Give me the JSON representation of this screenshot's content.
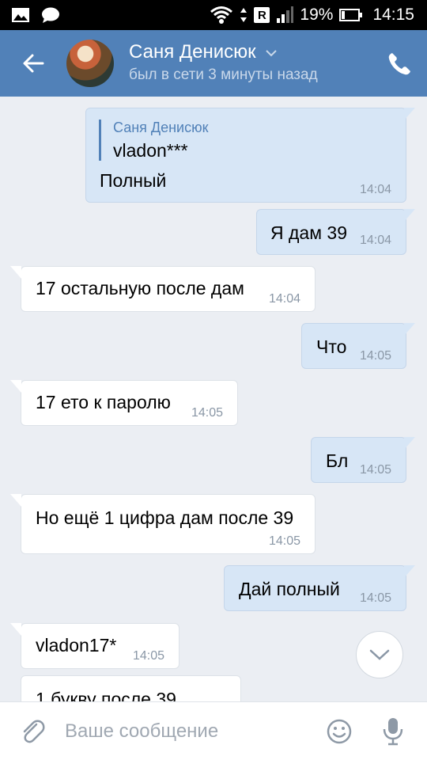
{
  "statusbar": {
    "battery": "19%",
    "battery_level": 0.19,
    "time": "14:15",
    "icons": [
      "image-icon",
      "chat-bubble-icon",
      "wifi-icon",
      "roaming-r-icon",
      "signal-icon",
      "battery-icon"
    ]
  },
  "header": {
    "contact_name": "Саня Денисюк",
    "status": "был в сети 3 минуты назад",
    "icons": [
      "back-arrow-icon",
      "chevron-down-icon",
      "phone-icon"
    ],
    "accent": "#5181b8"
  },
  "messages": [
    {
      "dir": "out",
      "quote_name": "Саня Денисюк",
      "quote_text": "vladon***",
      "text": "Полный",
      "time": "14:04"
    },
    {
      "dir": "out",
      "text": "Я дам 39",
      "time": "14:04"
    },
    {
      "dir": "in",
      "text": "17 остальную после дам",
      "time": "14:04"
    },
    {
      "dir": "out",
      "text": "Что",
      "time": "14:05"
    },
    {
      "dir": "in",
      "text": "17 ето к паролю",
      "time": "14:05"
    },
    {
      "dir": "out",
      "text": "Бл",
      "time": "14:05"
    },
    {
      "dir": "in",
      "text": "Но ещё 1 цифра дам после 39",
      "time": "14:05"
    },
    {
      "dir": "out",
      "text": "Дай полный",
      "time": "14:05"
    },
    {
      "dir": "in",
      "text": "vladon17*",
      "time": "14:05"
    },
    {
      "dir": "in",
      "text": "1 букву после 39",
      "time": ""
    }
  ],
  "composer": {
    "placeholder": "Ваше сообщение",
    "icons": [
      "paperclip-icon",
      "smiley-icon",
      "microphone-icon",
      "chevron-down-icon"
    ]
  },
  "colors": {
    "outgoing_bubble": "#d7e6f6",
    "incoming_bubble": "#ffffff",
    "background": "#ebeef3"
  }
}
